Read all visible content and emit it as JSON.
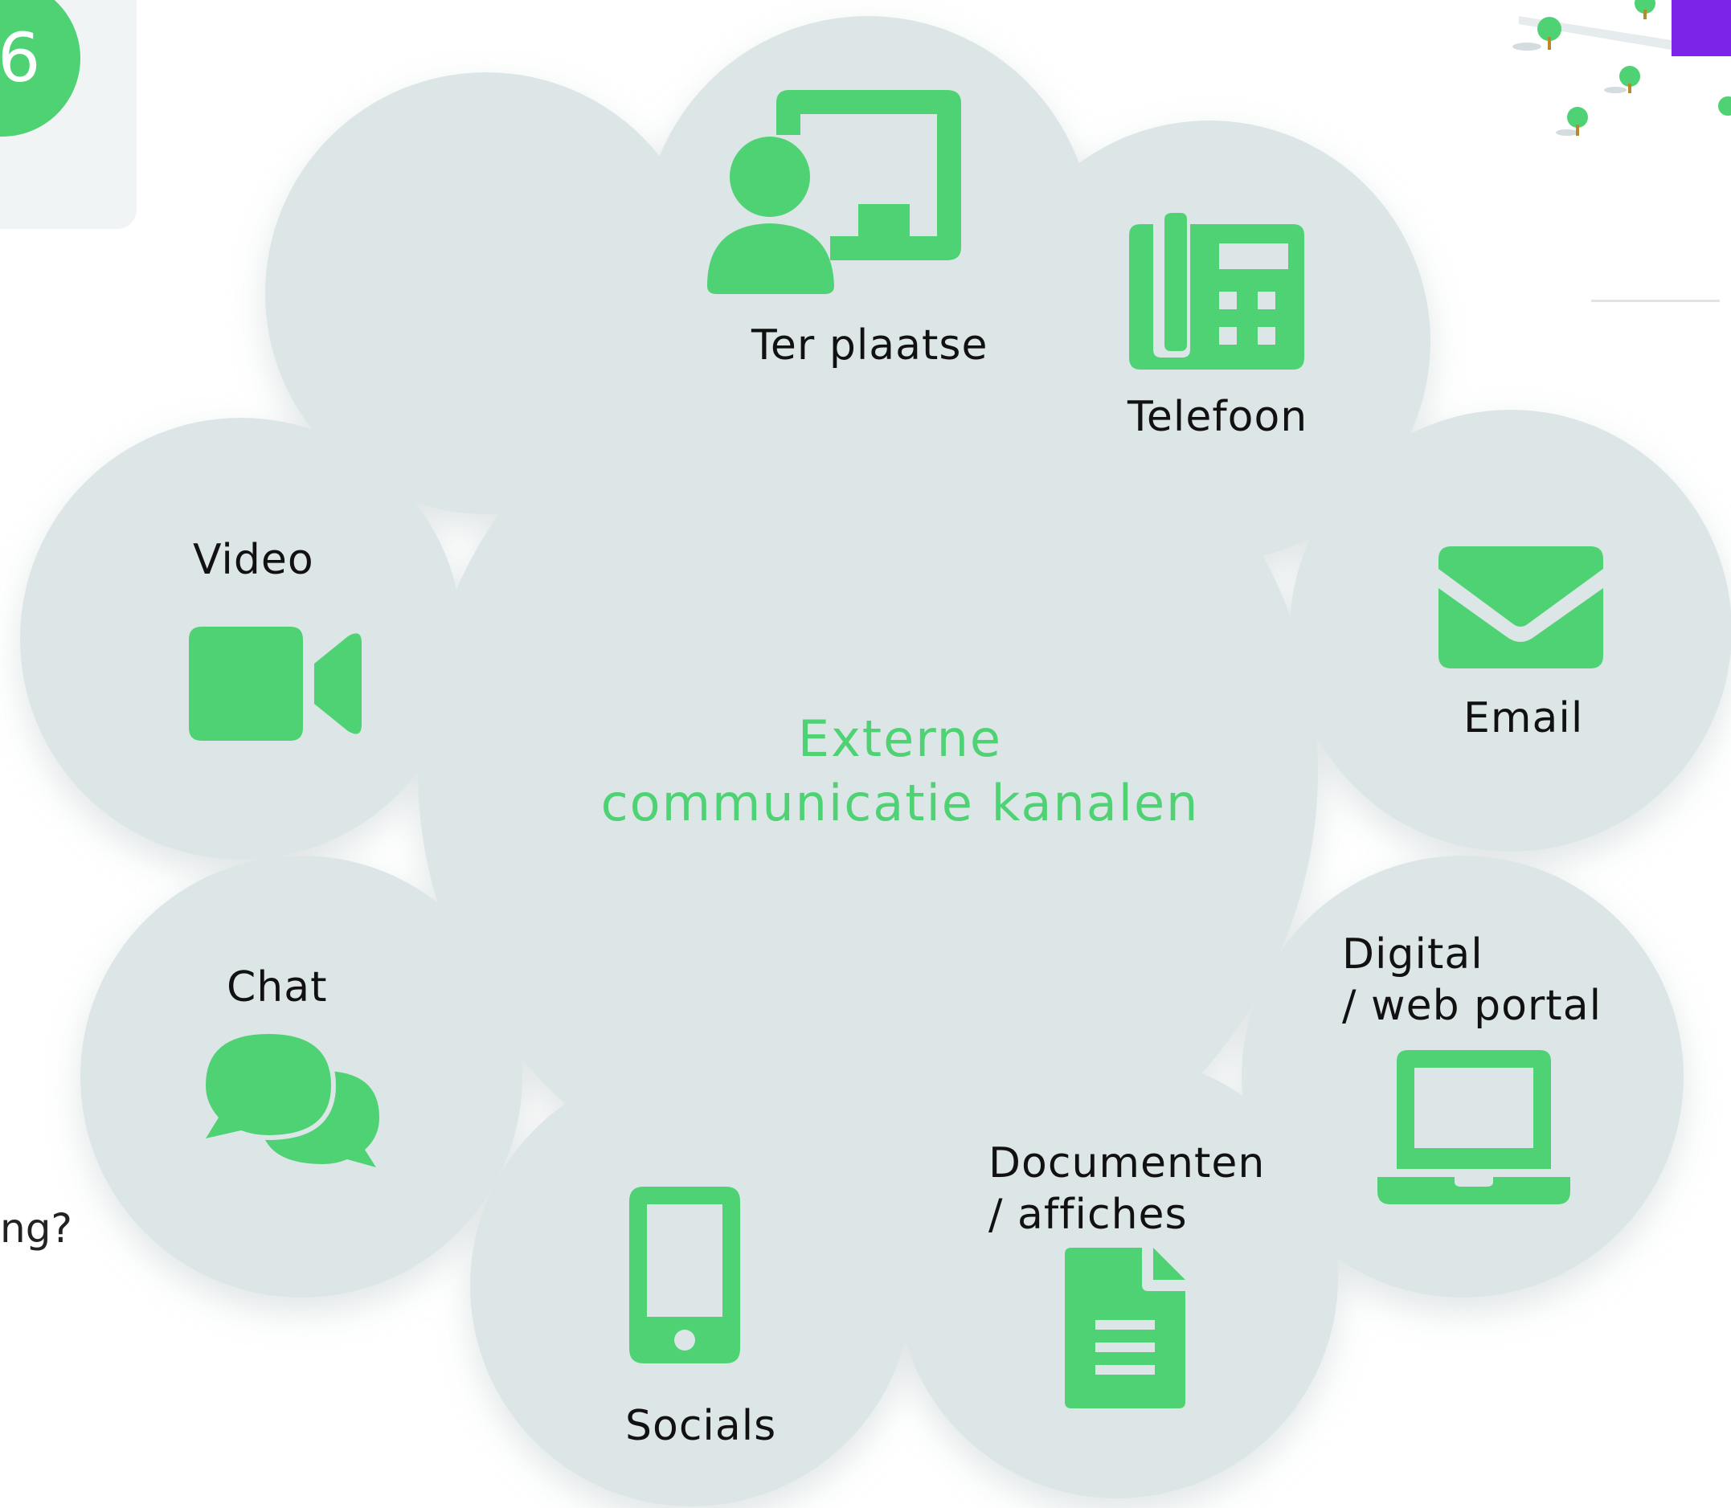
{
  "diagram": {
    "center_title_line1": "Externe",
    "center_title_line2": "communicatie kanalen",
    "channels": [
      {
        "label": "Ter plaatse",
        "icon": "presentation-person-icon"
      },
      {
        "label": "Telefoon",
        "icon": "desk-phone-icon"
      },
      {
        "label": "Email",
        "icon": "envelope-icon"
      },
      {
        "label_line1": "Digital",
        "label_line2": "/ web portal",
        "icon": "laptop-icon"
      },
      {
        "label_line1": "Documenten",
        "label_line2": "/ affiches",
        "icon": "document-icon"
      },
      {
        "label": "Socials",
        "icon": "smartphone-icon"
      },
      {
        "label": "Chat",
        "icon": "chat-bubbles-icon"
      },
      {
        "label": "Video",
        "icon": "video-camera-icon"
      }
    ]
  },
  "background": {
    "left_badge_text": "6",
    "left_fragment_text": "ng?"
  },
  "colors": {
    "accent_green": "#4fd274",
    "cloud_fill": "#dde6e7",
    "label_text": "#111111"
  }
}
